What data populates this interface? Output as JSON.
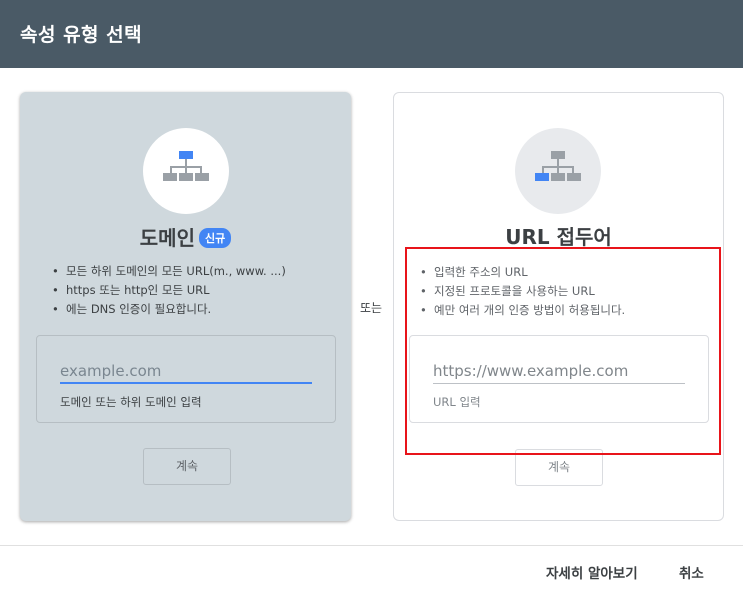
{
  "dialog": {
    "title": "속성 유형 선택"
  },
  "domain_card": {
    "icon": "sitemap-icon",
    "title": "도메인",
    "badge": "신규",
    "features": [
      "모든 하위 도메인의 모든 URL(m., www. ...)",
      "https 또는 http인 모든 URL",
      "에는 DNS 인증이 필요합니다."
    ],
    "input_placeholder": "example.com",
    "input_help": "도메인 또는 하위 도메인 입력",
    "continue_label": "계속"
  },
  "separator": "또는",
  "url_card": {
    "icon": "sitemap-icon",
    "title": "URL 접두어",
    "features": [
      "입력한 주소의 URL",
      "지정된 프로토콜을 사용하는 URL",
      "예만 여러 개의 인증 방법이 허용됩니다."
    ],
    "input_placeholder": "https://www.example.com",
    "input_help": "URL 입력",
    "continue_label": "계속"
  },
  "footer": {
    "learn_more": "자세히 알아보기",
    "cancel": "취소"
  },
  "colors": {
    "header": "#4a5a66",
    "accent": "#4285f4",
    "highlight": "#e8141a",
    "domain_card_bg": "#cfd8dd"
  }
}
